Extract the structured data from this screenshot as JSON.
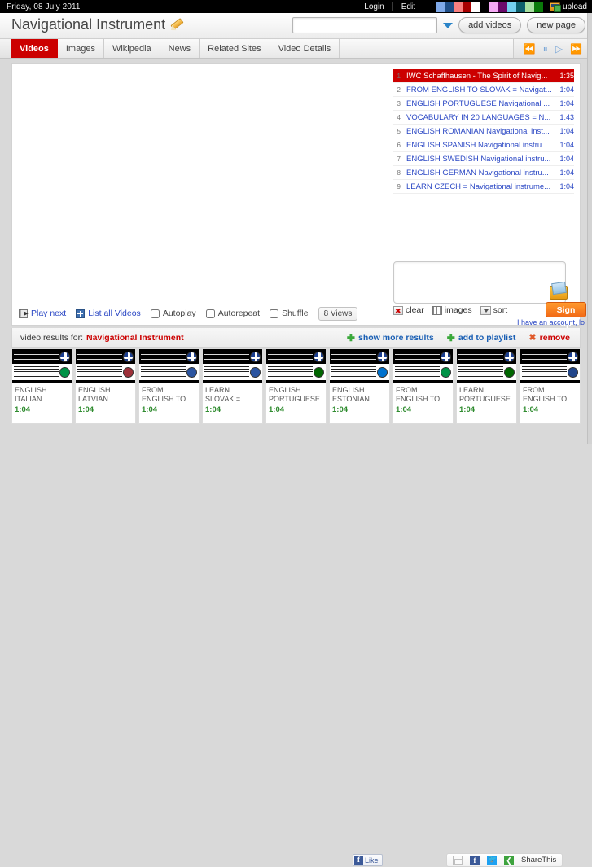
{
  "topbar": {
    "date": "Friday, 08 July 2011",
    "login_label": "Login",
    "edit_label": "Edit",
    "upload_label": "upload",
    "swatch_colors": [
      "#000000",
      "#7fa9e8",
      "#1f4e87",
      "#f98080",
      "#a80000",
      "#ffffff",
      "#000000",
      "#f5a9f5",
      "#6b0a6b",
      "#74d0ef",
      "#0c5f6b",
      "#a8e0a0",
      "#0a7a0a"
    ]
  },
  "title": {
    "text": "Navigational Instrument",
    "edit_icon": "pencil-icon"
  },
  "search": {
    "value": "",
    "placeholder": "",
    "dropdown_icon": "chevron-down-icon",
    "add_videos_label": "add videos",
    "new_page_label": "new page"
  },
  "tabs": [
    {
      "label": "Videos",
      "active": true
    },
    {
      "label": "Images",
      "active": false
    },
    {
      "label": "Wikipedia",
      "active": false
    },
    {
      "label": "News",
      "active": false
    },
    {
      "label": "Related Sites",
      "active": false
    },
    {
      "label": "Video Details",
      "active": false
    }
  ],
  "player_controls": [
    {
      "name": "rewind-button",
      "glyph": "⏪"
    },
    {
      "name": "pause-button",
      "glyph": "⏸"
    },
    {
      "name": "play-button",
      "glyph": "▷"
    },
    {
      "name": "fastforward-button",
      "glyph": "⏩"
    }
  ],
  "playlist": [
    {
      "num": "1",
      "title": "IWC Schaffhausen - The Spirit of Navig...",
      "duration": "1:35",
      "selected": true
    },
    {
      "num": "2",
      "title": "FROM ENGLISH TO SLOVAK = Navigat...",
      "duration": "1:04",
      "selected": false
    },
    {
      "num": "3",
      "title": "ENGLISH PORTUGUESE Navigational ...",
      "duration": "1:04",
      "selected": false
    },
    {
      "num": "4",
      "title": "VOCABULARY IN 20 LANGUAGES = N...",
      "duration": "1:43",
      "selected": false
    },
    {
      "num": "5",
      "title": "ENGLISH ROMANIAN Navigational inst...",
      "duration": "1:04",
      "selected": false
    },
    {
      "num": "6",
      "title": "ENGLISH SPANISH Navigational instru...",
      "duration": "1:04",
      "selected": false
    },
    {
      "num": "7",
      "title": "ENGLISH SWEDISH Navigational instru...",
      "duration": "1:04",
      "selected": false
    },
    {
      "num": "8",
      "title": "ENGLISH GERMAN Navigational instru...",
      "duration": "1:04",
      "selected": false
    },
    {
      "num": "9",
      "title": "LEARN CZECH = Navigational instrume...",
      "duration": "1:04",
      "selected": false
    }
  ],
  "comment": {
    "value": "",
    "placeholder": ""
  },
  "controls": {
    "play_next_label": "Play next",
    "list_all_label": "List all Videos",
    "autoplay_label": "Autoplay",
    "autorepeat_label": "Autorepeat",
    "shuffle_label": "Shuffle",
    "views_label": "8 Views",
    "autoplay_checked": false,
    "autorepeat_checked": false,
    "shuffle_checked": false
  },
  "right_controls": {
    "clear_label": "clear",
    "images_label": "images",
    "sort_label": "sort",
    "signup_label": "Sign up",
    "have_account_label": "I have an account, lo"
  },
  "results": {
    "prefix": "video results for:",
    "query": "Navigational Instrument",
    "show_more_label": "show more results",
    "add_playlist_label": "add to playlist",
    "remove_label": "remove"
  },
  "thumbnails": [
    {
      "title": "ENGLISH ITALIAN",
      "duration": "1:04",
      "flag2": "#009246"
    },
    {
      "title": "ENGLISH LATVIAN",
      "duration": "1:04",
      "flag2": "#9e3039"
    },
    {
      "title": "FROM ENGLISH TO SLOVENIAN",
      "duration": "1:04",
      "flag2": "#2b54a0"
    },
    {
      "title": "LEARN SLOVAK = Navigational",
      "duration": "1:04",
      "flag2": "#2b54a0"
    },
    {
      "title": "ENGLISH PORTUGUESE",
      "duration": "1:04",
      "flag2": "#006600"
    },
    {
      "title": "ENGLISH ESTONIAN",
      "duration": "1:04",
      "flag2": "#0072ce"
    },
    {
      "title": "FROM ENGLISH TO ITALIAN =",
      "duration": "1:04",
      "flag2": "#009246"
    },
    {
      "title": "LEARN PORTUGUESE =",
      "duration": "1:04",
      "flag2": "#006600"
    },
    {
      "title": "FROM ENGLISH TO DUTCH =",
      "duration": "1:04",
      "flag2": "#21468b"
    }
  ],
  "footer": {
    "like_label": "Like",
    "fb_glyph": "f",
    "share_label": "ShareThis"
  }
}
